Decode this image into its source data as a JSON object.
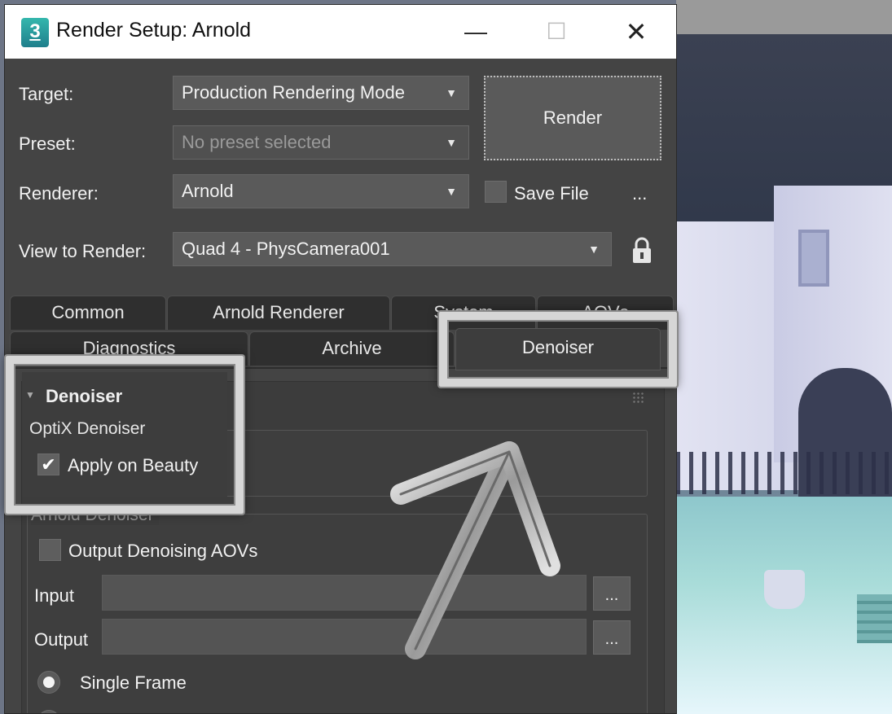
{
  "window": {
    "app_icon_text": "3",
    "title": "Render Setup: Arnold",
    "minimize": "—",
    "maximize": "☐",
    "close": "✕"
  },
  "settings": {
    "target_label": "Target:",
    "target_value": "Production Rendering Mode",
    "preset_label": "Preset:",
    "preset_value": "No preset selected",
    "renderer_label": "Renderer:",
    "renderer_value": "Arnold",
    "view_label": "View to Render:",
    "view_value": "Quad 4 - PhysCamera001",
    "render_button": "Render",
    "save_file_label": "Save File",
    "save_file_checked": false,
    "more": "..."
  },
  "tabs": {
    "row1": [
      "Common",
      "Arnold Renderer",
      "System",
      "AOVs"
    ],
    "row2": [
      "Diagnostics",
      "Archive",
      "Denoiser"
    ],
    "active": "Denoiser"
  },
  "denoiser": {
    "rollout_title": "Denoiser",
    "optix_group": "OptiX Denoiser",
    "apply_on_beauty": "Apply on Beauty",
    "apply_on_beauty_checked": true,
    "arnold_group": "Arnold Denoiser",
    "output_aovs": "Output Denoising AOVs",
    "output_aovs_checked": false,
    "input_label": "Input",
    "output_label": "Output",
    "browse": "...",
    "single_frame": "Single Frame"
  },
  "colors": {
    "dialog_bg": "#444444",
    "titlebar_bg": "#ffffff",
    "callout": "#d6d6d6"
  }
}
